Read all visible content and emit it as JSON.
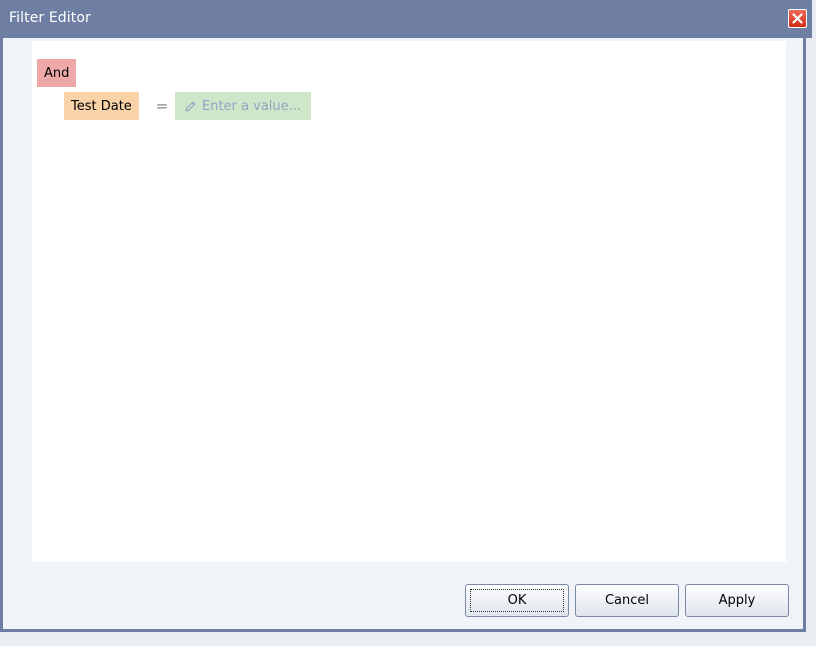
{
  "window": {
    "title": "Filter Editor"
  },
  "filter": {
    "group_operator": "And",
    "condition": {
      "field": "Test Date",
      "operator": "=",
      "value_placeholder": "Enter a value..."
    }
  },
  "buttons": {
    "ok": "OK",
    "cancel": "Cancel",
    "apply": "Apply"
  },
  "icons": {
    "close": "close-icon",
    "edit": "pencil-icon"
  },
  "colors": {
    "titlebar": "#6e7fa3",
    "group_node": "#efa8a8",
    "field_node": "#f9d2a8",
    "value_node": "#cfe6cb",
    "close_button": "#d02c14"
  }
}
